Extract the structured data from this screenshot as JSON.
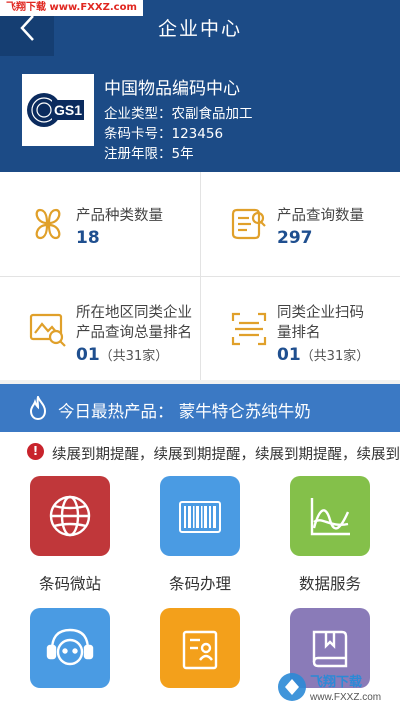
{
  "watermark_top": "飞翔下载 www.FXXZ.com",
  "header": {
    "title": "企业中心"
  },
  "company": {
    "name": "中国物品编码中心",
    "logo_text": "GS1",
    "type_line": "企业类型：农副食品加工",
    "card_line": "条码卡号：123456",
    "years_line": "注册年限：5年"
  },
  "stats": [
    {
      "label": "产品种类数量",
      "value": "18",
      "icon": "clover-icon"
    },
    {
      "label": "产品查询数量",
      "value": "297",
      "icon": "search-doc-icon"
    },
    {
      "label_line1": "所在地区同类企业",
      "label_line2": "产品查询总量排名",
      "value": "01",
      "unit": "（共31家）",
      "icon": "image-search-icon"
    },
    {
      "label_line1": "同类企业扫码",
      "label_line2": "量排名",
      "value": "01",
      "unit": "（共31家）",
      "icon": "scan-icon"
    }
  ],
  "hot": {
    "text": "今日最热产品： 蒙牛特仑苏纯牛奶"
  },
  "notice": {
    "text": "续展到期提醒，续展到期提醒，续展到期提醒，续展到期提醒"
  },
  "tiles": [
    {
      "label": "条码微站",
      "color": "#c0373a",
      "icon": "globe-icon"
    },
    {
      "label": "条码办理",
      "color": "#4a9be3",
      "icon": "barcode-icon"
    },
    {
      "label": "数据服务",
      "color": "#84c04a",
      "icon": "chart-icon"
    },
    {
      "label": "",
      "color": "#4a9be3",
      "icon": "support-icon"
    },
    {
      "label": "",
      "color": "#f3a01b",
      "icon": "id-card-icon"
    },
    {
      "label": "",
      "color": "#8a7bb8",
      "icon": "book-icon"
    }
  ],
  "watermark_br": {
    "brand": "飞翔下载",
    "url": "www.FXXZ.com"
  }
}
